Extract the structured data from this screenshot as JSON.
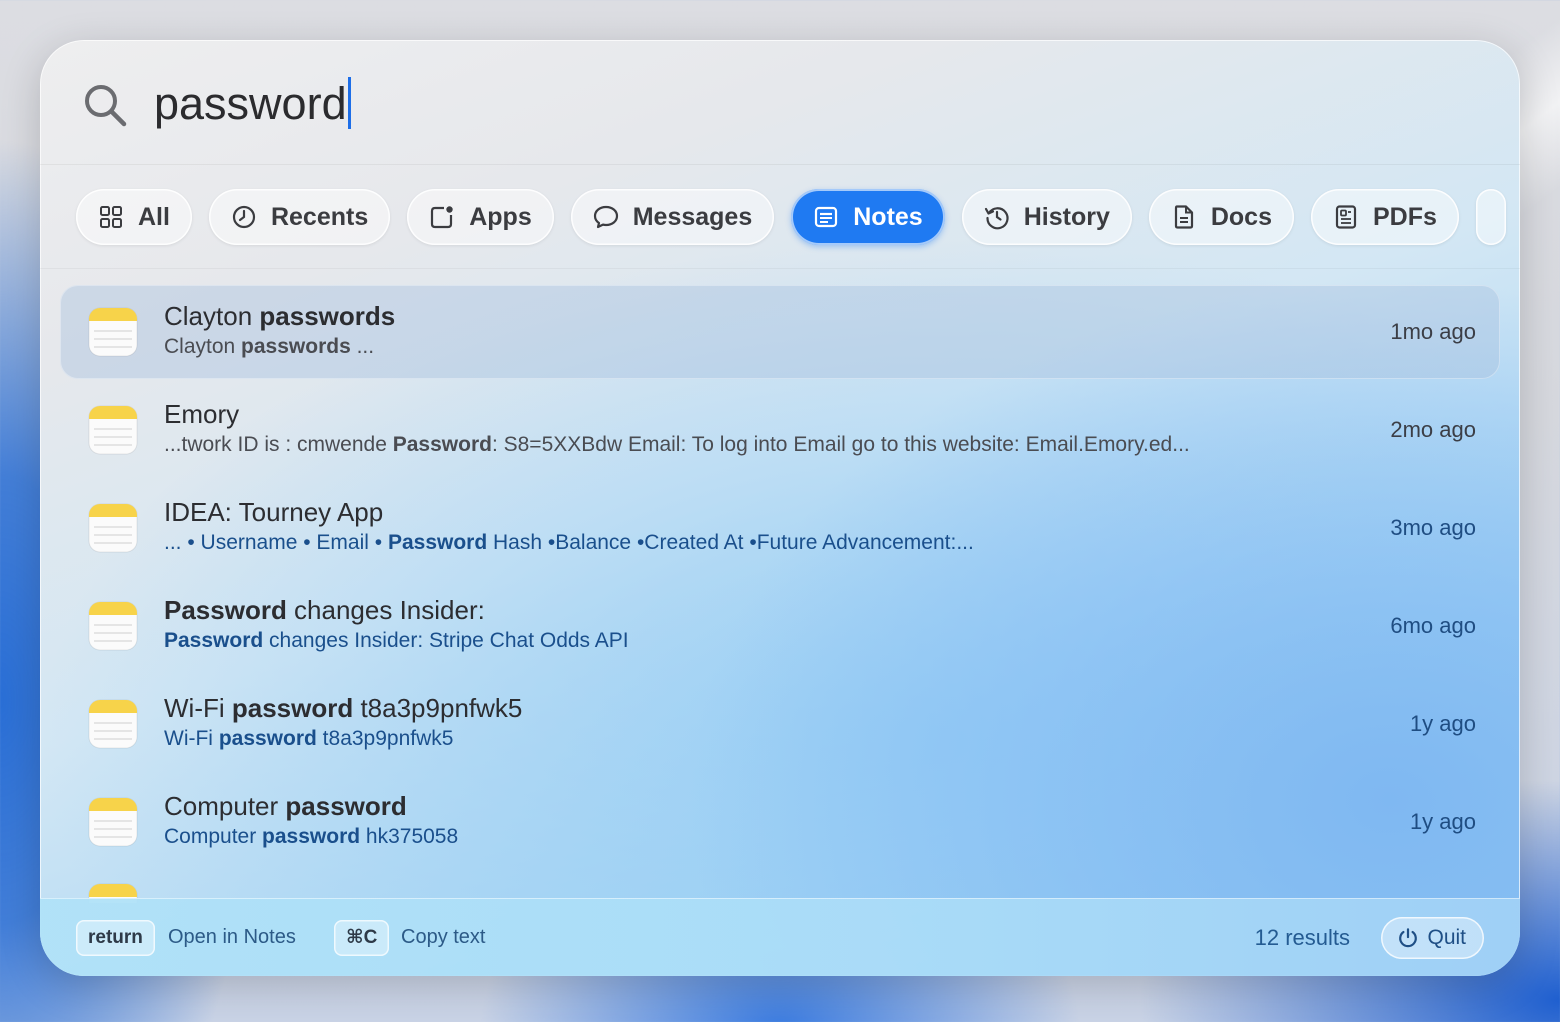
{
  "search": {
    "query": "password"
  },
  "tabs": [
    {
      "label": "All",
      "icon": "grid-icon",
      "active": false
    },
    {
      "label": "Recents",
      "icon": "clock-icon",
      "active": false
    },
    {
      "label": "Apps",
      "icon": "app-icon",
      "active": false
    },
    {
      "label": "Messages",
      "icon": "message-bubble-icon",
      "active": false
    },
    {
      "label": "Notes",
      "icon": "note-icon",
      "active": true
    },
    {
      "label": "History",
      "icon": "history-icon",
      "active": false
    },
    {
      "label": "Docs",
      "icon": "document-icon",
      "active": false
    },
    {
      "label": "PDFs",
      "icon": "pdf-icon",
      "active": false
    }
  ],
  "results": [
    {
      "title_parts": [
        {
          "text": "Clayton ",
          "bold": false
        },
        {
          "text": "passwords",
          "bold": true
        }
      ],
      "sub_parts": [
        {
          "text": "Clayton ",
          "bold": false
        },
        {
          "text": "passwords",
          "bold": true
        },
        {
          "text": " ...",
          "bold": false
        }
      ],
      "time": "1mo ago",
      "selected": true,
      "blue": false
    },
    {
      "title_parts": [
        {
          "text": "Emory",
          "bold": false
        }
      ],
      "sub_parts": [
        {
          "text": "...twork ID is : cmwende   ",
          "bold": false
        },
        {
          "text": "Password",
          "bold": true
        },
        {
          "text": ": S8=5XXBdw  Email: To log into Email go to this website: Email.Emory.ed...",
          "bold": false
        }
      ],
      "time": "2mo ago",
      "selected": false,
      "blue": false
    },
    {
      "title_parts": [
        {
          "text": "IDEA: Tourney App",
          "bold": false
        }
      ],
      "sub_parts": [
        {
          "text": "...      •       Username       •       Email       •       ",
          "bold": false
        },
        {
          "text": "Password",
          "bold": true
        },
        {
          "text": " Hash •Balance •Created At •Future Advancement:...",
          "bold": false
        }
      ],
      "time": "3mo ago",
      "selected": false,
      "blue": true
    },
    {
      "title_parts": [
        {
          "text": "Password",
          "bold": true
        },
        {
          "text": " changes Insider:",
          "bold": false
        }
      ],
      "sub_parts": [
        {
          "text": "Password",
          "bold": true
        },
        {
          "text": " changes Insider:   Stripe  Chat  Odds API",
          "bold": false
        }
      ],
      "time": "6mo ago",
      "selected": false,
      "blue": true
    },
    {
      "title_parts": [
        {
          "text": "Wi-Fi ",
          "bold": false
        },
        {
          "text": "password",
          "bold": true
        },
        {
          "text": " t8a3p9pnfwk5",
          "bold": false
        }
      ],
      "sub_parts": [
        {
          "text": "Wi-Fi ",
          "bold": false
        },
        {
          "text": "password",
          "bold": true
        },
        {
          "text": " t8a3p9pnfwk5",
          "bold": false
        }
      ],
      "time": "1y ago",
      "selected": false,
      "blue": true
    },
    {
      "title_parts": [
        {
          "text": "Computer ",
          "bold": false
        },
        {
          "text": "password",
          "bold": true
        }
      ],
      "sub_parts": [
        {
          "text": "Computer ",
          "bold": false
        },
        {
          "text": "password",
          "bold": true
        },
        {
          "text": "   hk375058",
          "bold": false
        }
      ],
      "time": "1y ago",
      "selected": false,
      "blue": true
    }
  ],
  "footer": {
    "key1": "return",
    "key1_label": "Open in Notes",
    "key2": "⌘C",
    "key2_label": "Copy text",
    "count": "12 results",
    "quit_label": "Quit"
  },
  "colors": {
    "accent": "#1f7af2",
    "note_yellow": "#f7d34a"
  }
}
